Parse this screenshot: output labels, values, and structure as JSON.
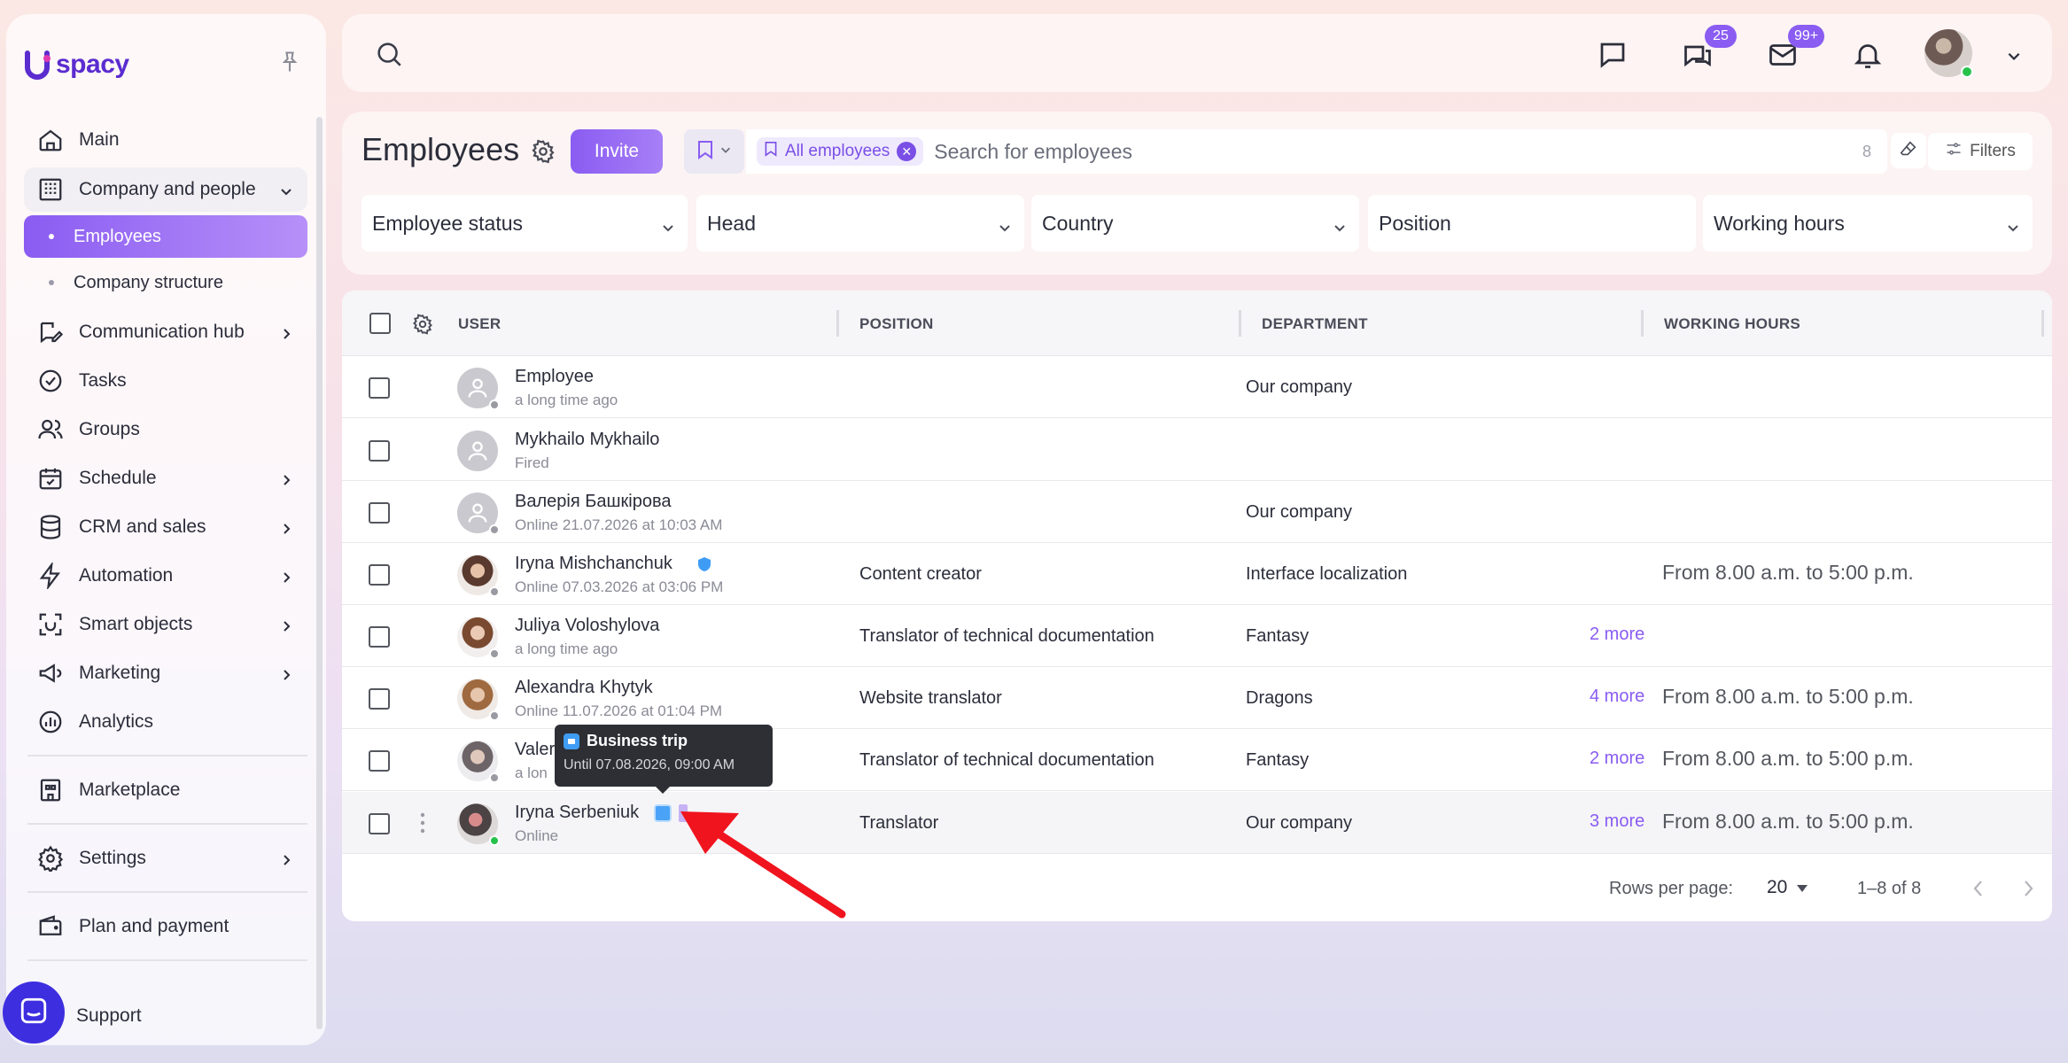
{
  "app": {
    "logo_text": "spacy",
    "brand_color": "#8a5cf2"
  },
  "sidebar": {
    "items": [
      {
        "label": "Main",
        "icon": "home-icon"
      },
      {
        "label": "Company and people",
        "icon": "building-icon",
        "expanded": true
      },
      {
        "label": "Employees",
        "active": true
      },
      {
        "label": "Company structure"
      },
      {
        "label": "Communication hub",
        "icon": "chat-edit-icon"
      },
      {
        "label": "Tasks",
        "icon": "check-circle-icon"
      },
      {
        "label": "Groups",
        "icon": "users-icon"
      },
      {
        "label": "Schedule",
        "icon": "calendar-check-icon"
      },
      {
        "label": "CRM and sales",
        "icon": "database-icon"
      },
      {
        "label": "Automation",
        "icon": "lightning-icon"
      },
      {
        "label": "Smart objects",
        "icon": "scan-icon"
      },
      {
        "label": "Marketing",
        "icon": "megaphone-icon"
      },
      {
        "label": "Analytics",
        "icon": "chart-circle-icon"
      },
      {
        "label": "Marketplace",
        "icon": "store-icon"
      },
      {
        "label": "Settings",
        "icon": "gear-icon"
      },
      {
        "label": "Plan and payment",
        "icon": "wallet-icon"
      },
      {
        "label": "Support",
        "icon": "support-chat-icon"
      }
    ]
  },
  "topbar": {
    "chats_badge": "25",
    "mail_badge": "99+"
  },
  "filters": {
    "title": "Employees",
    "invite_label": "Invite",
    "chip_label": "All employees",
    "search_placeholder": "Search for employees",
    "count": "8",
    "filters_label": "Filters",
    "selects": [
      "Employee status",
      "Head",
      "Country",
      "Position",
      "Working hours"
    ]
  },
  "table": {
    "headers": {
      "user": "USER",
      "position": "POSITION",
      "department": "DEPARTMENT",
      "hours": "WORKING HOURS"
    },
    "rows": [
      {
        "name": "Employee",
        "sub": "a long time ago",
        "position": "",
        "department": "Our company",
        "more": "",
        "hours": ""
      },
      {
        "name": "Mykhailo Mykhailo",
        "sub": "Fired",
        "position": "",
        "department": "",
        "more": "",
        "hours": ""
      },
      {
        "name": "Валерія Башкірова",
        "sub": "Online 21.07.2026 at 10:03 AM",
        "position": "",
        "department": "Our company",
        "more": "",
        "hours": ""
      },
      {
        "name": "Iryna Mishchanchuk",
        "sub": "Online 07.03.2026 at 03:06 PM",
        "position": "Content creator",
        "department": "Interface localization",
        "more": "",
        "hours": "From 8.00 a.m. to 5:00 p.m."
      },
      {
        "name": "Juliya Voloshylova",
        "sub": "a long time ago",
        "position": "Translator of technical documentation",
        "department": "Fantasy",
        "more": "2 more",
        "hours": ""
      },
      {
        "name": "Alexandra Khytyk",
        "sub": "Online 11.07.2026 at 01:04 PM",
        "position": "Website translator",
        "department": "Dragons",
        "more": "4 more",
        "hours": "From 8.00 a.m. to 5:00 p.m."
      },
      {
        "name": "Valer",
        "sub": "a lon",
        "position": "Translator of technical documentation",
        "department": "Fantasy",
        "more": "2 more",
        "hours": "From 8.00 a.m. to 5:00 p.m."
      },
      {
        "name": "Iryna Serbeniuk",
        "sub": "Online",
        "position": "Translator",
        "department": "Our company",
        "more": "3 more",
        "hours": "From 8.00 a.m. to 5:00 p.m."
      }
    ],
    "footer": {
      "rows_per_page_label": "Rows per page:",
      "rows_per_page": "20",
      "range": "1–8 of 8"
    }
  },
  "tooltip": {
    "title": "Business trip",
    "subtitle": "Until 07.08.2026, 09:00 AM"
  }
}
